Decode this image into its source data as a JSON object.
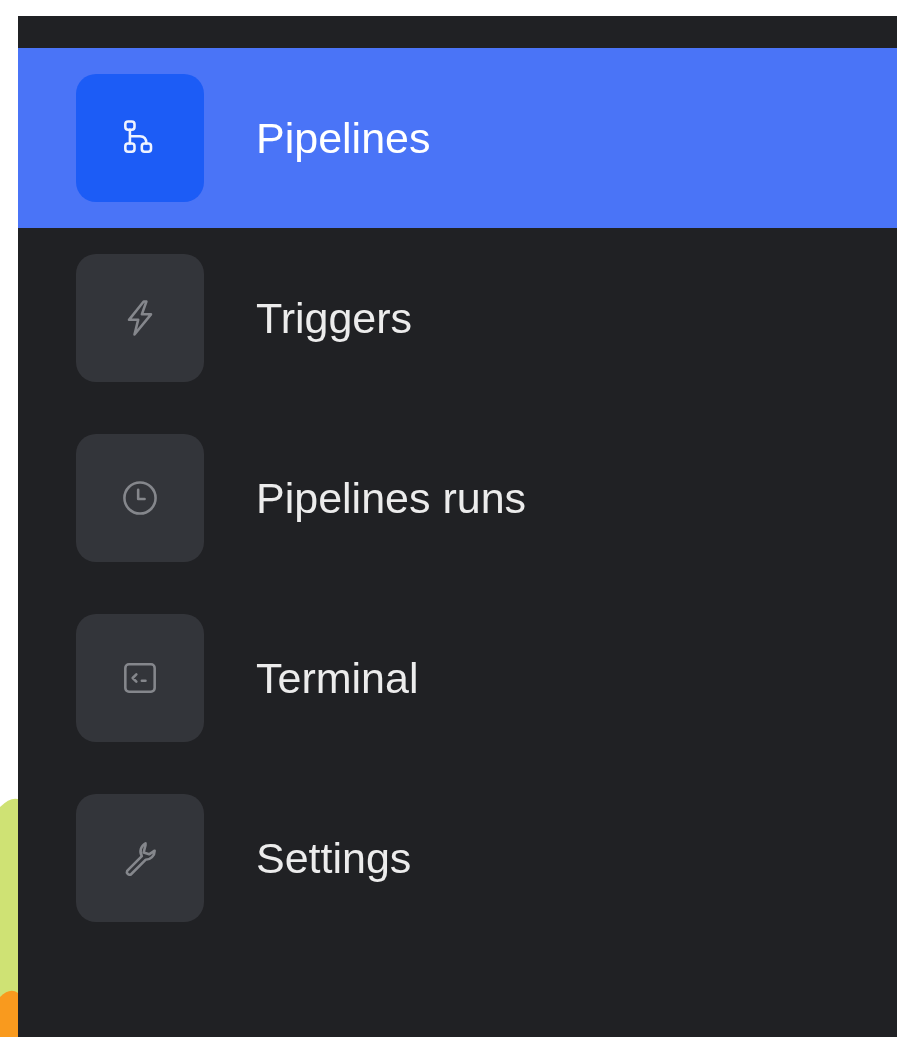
{
  "sidebar": {
    "items": [
      {
        "label": "Pipelines",
        "selected": true
      },
      {
        "label": "Triggers",
        "selected": false
      },
      {
        "label": "Pipelines runs",
        "selected": false
      },
      {
        "label": "Terminal",
        "selected": false
      },
      {
        "label": "Settings",
        "selected": false
      }
    ]
  }
}
